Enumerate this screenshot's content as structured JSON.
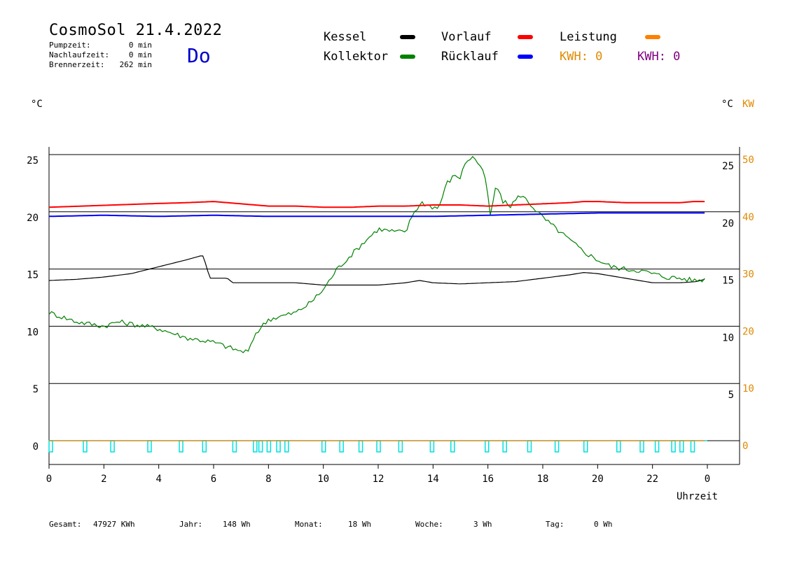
{
  "header": {
    "title": "CosmoSol 21.4.2022",
    "day": "Do",
    "stats": [
      {
        "label": "Pumpzeit:",
        "value": "0 min"
      },
      {
        "label": "Nachlaufzeit:",
        "value": "0 min"
      },
      {
        "label": "Brennerzeit:",
        "value": "262 min"
      }
    ]
  },
  "legend": [
    {
      "name": "Kessel",
      "color": "#000000"
    },
    {
      "name": "Vorlauf",
      "color": "#ff0000"
    },
    {
      "name": "Leistung",
      "color": "#ff8000"
    },
    {
      "name": "Kollektor",
      "color": "#008000"
    },
    {
      "name": "Rücklauf",
      "color": "#0000ff"
    }
  ],
  "kwh": [
    {
      "label": "KWH: 0",
      "color": "#e08a00"
    },
    {
      "label": "KWH: 0",
      "color": "#800080"
    }
  ],
  "units": {
    "left": "°C",
    "right_c": "°C",
    "right_kw": "KW"
  },
  "footer": {
    "gesamt_label": "Gesamt:",
    "gesamt_value": "47927 KWh",
    "jahr_label": "Jahr:",
    "jahr_value": "148 Wh",
    "monat_label": "Monat:",
    "monat_value": "18 Wh",
    "woche_label": "Woche:",
    "woche_value": "3 Wh",
    "tag_label": "Tag:",
    "tag_value": "0 Wh"
  },
  "chart_data": {
    "type": "line",
    "xlabel": "Uhrzeit",
    "x_ticks": [
      "0",
      "2",
      "4",
      "6",
      "8",
      "10",
      "12",
      "14",
      "16",
      "18",
      "20",
      "22",
      "0"
    ],
    "xlim": [
      0,
      24
    ],
    "ylim_left": [
      0,
      25
    ],
    "left_ticks": [
      0,
      5,
      10,
      15,
      20,
      25
    ],
    "right_c_ticks": [
      5,
      10,
      15,
      20,
      25
    ],
    "right_kw_ticks": [
      0,
      10,
      20,
      30,
      40,
      50
    ],
    "grid": true,
    "series": [
      {
        "name": "Kessel",
        "color": "#000000",
        "x": [
          0,
          1,
          2,
          3,
          4,
          5,
          5.6,
          5.75,
          5.85,
          6,
          6.5,
          6.7,
          7,
          8,
          9,
          10,
          11,
          12,
          13,
          13.5,
          14,
          15,
          16,
          17,
          18,
          19,
          19.5,
          20,
          21,
          22,
          23,
          23.6,
          23.9
        ],
        "y": [
          14.0,
          14.1,
          14.3,
          14.6,
          15.2,
          15.8,
          16.2,
          15.2,
          14.2,
          14.2,
          14.2,
          13.8,
          13.8,
          13.8,
          13.8,
          13.6,
          13.6,
          13.6,
          13.8,
          14.0,
          13.8,
          13.7,
          13.8,
          13.9,
          14.2,
          14.5,
          14.7,
          14.6,
          14.2,
          13.8,
          13.8,
          13.9,
          14.1
        ]
      },
      {
        "name": "Kollektor",
        "color": "#008000",
        "x": [
          0,
          0.5,
          1,
          2,
          2.5,
          3,
          3.5,
          4,
          5,
          6,
          6.5,
          7,
          7.3,
          7.5,
          8,
          9,
          9.5,
          10,
          10.5,
          11,
          11.5,
          12,
          12.5,
          13,
          13.3,
          13.6,
          13.9,
          14.2,
          14.5,
          14.8,
          15,
          15.2,
          15.5,
          15.7,
          15.9,
          16.1,
          16.3,
          16.5,
          16.8,
          17.2,
          17.5,
          18,
          18.5,
          19,
          19.5,
          20,
          20.5,
          21,
          21.5,
          22,
          22.5,
          23,
          23.5,
          23.9
        ],
        "y": [
          11.2,
          10.8,
          10.4,
          10.0,
          10.4,
          10.2,
          10.0,
          9.8,
          9.0,
          8.6,
          8.2,
          7.8,
          7.8,
          9.3,
          10.6,
          11.2,
          12.0,
          13.2,
          15.0,
          16.2,
          17.4,
          18.5,
          18.3,
          18.2,
          20.0,
          20.8,
          20.5,
          20.3,
          22.5,
          23.2,
          23.0,
          24.5,
          24.8,
          24.0,
          23.0,
          19.5,
          22.5,
          21.0,
          20.5,
          21.5,
          20.8,
          19.5,
          18.5,
          17.5,
          16.5,
          15.8,
          15.2,
          15.0,
          14.9,
          14.6,
          14.3,
          14.2,
          14.0,
          14.1
        ]
      },
      {
        "name": "Vorlauf",
        "color": "#ff0000",
        "x": [
          0,
          2.4,
          3.6,
          5,
          6,
          7,
          8,
          9,
          10,
          11,
          12,
          13,
          14,
          15,
          16,
          17,
          18,
          19,
          19.5,
          20,
          21,
          22,
          23,
          23.5,
          23.9
        ],
        "y": [
          20.4,
          20.6,
          20.7,
          20.8,
          20.9,
          20.7,
          20.5,
          20.5,
          20.4,
          20.4,
          20.5,
          20.5,
          20.6,
          20.6,
          20.5,
          20.6,
          20.7,
          20.8,
          20.9,
          20.9,
          20.8,
          20.8,
          20.8,
          20.9,
          20.9
        ]
      },
      {
        "name": "Rücklauf",
        "color": "#0000ff",
        "x": [
          0,
          2,
          4,
          6,
          8,
          10,
          12,
          14,
          16,
          18,
          20,
          22,
          23.9
        ],
        "y": [
          19.6,
          19.7,
          19.6,
          19.7,
          19.6,
          19.6,
          19.6,
          19.6,
          19.7,
          19.8,
          19.9,
          19.9,
          19.9
        ]
      },
      {
        "name": "Leistung",
        "color": "#ff8000",
        "x": [
          0,
          23.9
        ],
        "y": [
          0,
          0
        ]
      }
    ],
    "pulses_x": [
      0,
      1.25,
      2.25,
      3.6,
      4.75,
      5.6,
      6.7,
      7.45,
      7.65,
      7.95,
      8.3,
      8.6,
      9.95,
      10.6,
      11.3,
      11.95,
      12.75,
      13.9,
      14.65,
      15.9,
      16.55,
      17.45,
      18.45,
      19.5,
      20.7,
      21.55,
      22.1,
      22.7,
      23.0,
      23.4
    ]
  }
}
